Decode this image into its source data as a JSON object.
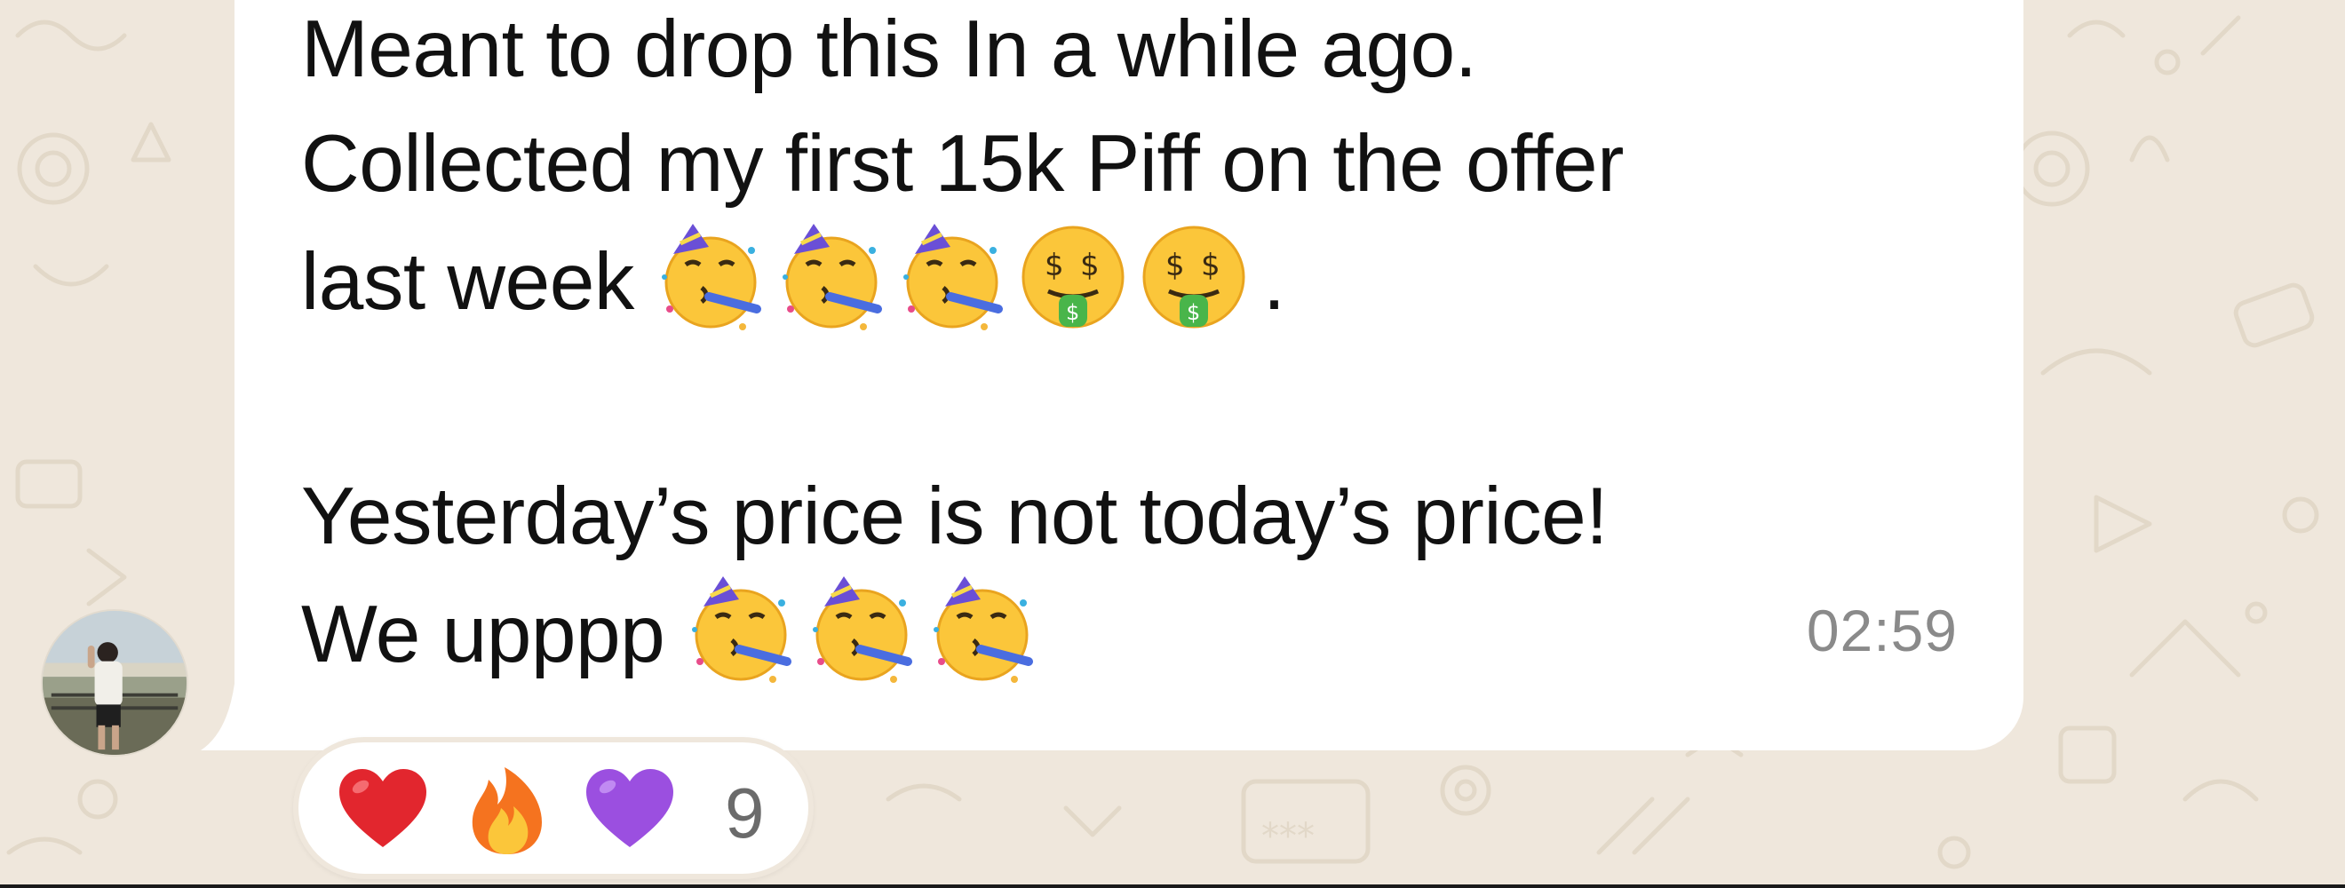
{
  "message": {
    "line1": "Meant to drop this In a while ago.",
    "line2": "Collected my first 15k Piff on the offer",
    "line3_text": "last week",
    "line3_emojis": [
      "partying-face",
      "partying-face",
      "partying-face",
      "money-mouth-face",
      "money-mouth-face"
    ],
    "line3_suffix": ".",
    "line4": "Yesterday’s price is not today’s price!",
    "line5_text": "We upppp",
    "line5_emojis": [
      "partying-face",
      "partying-face",
      "partying-face"
    ],
    "timestamp": "02:59"
  },
  "reactions": {
    "emojis": [
      "red-heart",
      "fire",
      "purple-heart"
    ],
    "count": "9"
  },
  "colors": {
    "chat_background": "#efe7dc",
    "bubble": "#ffffff",
    "text": "#111111",
    "timestamp": "#8a8a8a"
  },
  "icons": {
    "avatar": "sender-avatar-photo"
  }
}
